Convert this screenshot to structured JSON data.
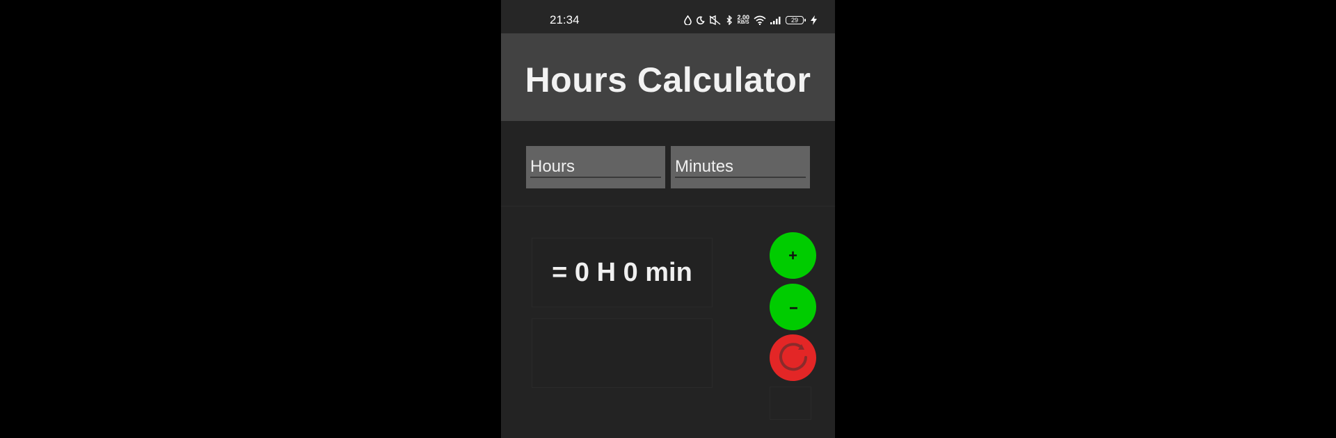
{
  "status_bar": {
    "time": "21:34",
    "icons": [
      "droplet-icon",
      "moon-icon",
      "mute-icon",
      "bluetooth-icon",
      "wifi-icon",
      "signal-icon",
      "charging-icon"
    ],
    "net_speed_value": "2.00",
    "net_speed_unit": "KB/S",
    "battery_level": "29"
  },
  "header": {
    "title": "Hours Calculator"
  },
  "inputs": {
    "hours_placeholder": "Hours",
    "minutes_placeholder": "Minutes"
  },
  "result": {
    "text": "= 0 H 0 min"
  },
  "buttons": {
    "add_label": "+",
    "subtract_label": "--",
    "reset_icon": "refresh-icon"
  },
  "colors": {
    "title_bar": "#424242",
    "background": "#232323",
    "input_bg": "#636363",
    "add_button": "#00cc00",
    "subtract_button": "#00cc00",
    "reset_button": "#e32626"
  }
}
